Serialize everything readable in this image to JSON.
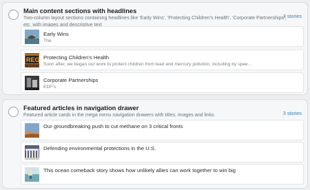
{
  "sections": [
    {
      "title": "Main content sections with headlines",
      "description": "Two-column layout sections containing headlines like 'Early Wins', 'Protecting Children's Health', 'Corporate Partnerships', etc. with images and descriptive text",
      "count": "3 stories",
      "items": [
        {
          "title": "Early Wins",
          "subtitle": "The",
          "thumb": "bird-photo-icon"
        },
        {
          "title": "Protecting Children's Health",
          "subtitle": "Soon after, we began our work to protect children from lead and mercury pollution, including by spee...",
          "thumb": "regulation-sign-photo-icon"
        },
        {
          "title": "Corporate Partnerships",
          "subtitle": "EDF's",
          "thumb": "building-photo-icon"
        }
      ]
    },
    {
      "title": "Featured articles in navigation drawer",
      "description": "Featured article cards in the mega menu navigation drawers with titles, images and links",
      "count": "3 stories",
      "items": [
        {
          "title": "Our groundbreaking push to cut methane on 3 critical fronts",
          "subtitle": "",
          "thumb": "sky-photo-icon"
        },
        {
          "title": "Defending environmental protections in the U.S.",
          "subtitle": "",
          "thumb": "capitol-photo-icon"
        },
        {
          "title": "This ocean comeback story shows how unlikely allies can work together to win big",
          "subtitle": "",
          "thumb": "ocean-photo-icon"
        }
      ]
    }
  ]
}
